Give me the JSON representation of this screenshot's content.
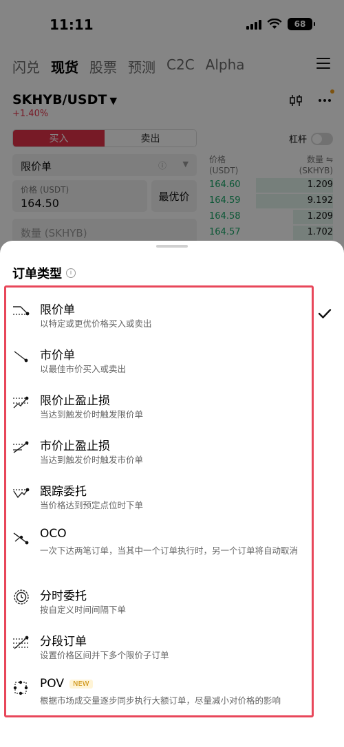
{
  "status_bar": {
    "time": "11:11",
    "battery": "68"
  },
  "nav_tabs": [
    {
      "label": "闪兑",
      "active": false
    },
    {
      "label": "现货",
      "active": true
    },
    {
      "label": "股票",
      "active": false
    },
    {
      "label": "预测",
      "active": false
    },
    {
      "label": "C2C",
      "active": false
    },
    {
      "label": "Alpha",
      "active": false
    }
  ],
  "market": {
    "pair": "SKHYB/USDT",
    "change": "+1.40%"
  },
  "trade_panel": {
    "buy_label": "买入",
    "sell_label": "卖出",
    "order_type_value": "限价单",
    "price_label": "价格 (USDT)",
    "price_value": "164.50",
    "best_price_label": "最优价",
    "quantity_placeholder": "数量 (SKHYB)",
    "leverage_label": "杠杆"
  },
  "order_book": {
    "price_header_1": "价格",
    "price_header_2": "(USDT)",
    "qty_header_1": "数量 ⇋",
    "qty_header_2": "(SKHYB)",
    "rows": [
      {
        "price": "164.60",
        "qty": "1.209",
        "depth": 0.62
      },
      {
        "price": "164.59",
        "qty": "9.192",
        "depth": 0.62
      },
      {
        "price": "164.58",
        "qty": "1.209",
        "depth": 0.32
      },
      {
        "price": "164.57",
        "qty": "1.702",
        "depth": 0.32
      }
    ]
  },
  "sheet": {
    "title": "订单类型",
    "selected_index": 0,
    "options": [
      {
        "name": "限价单",
        "desc": "以特定或更优价格买入或卖出",
        "icon": "limit-order-icon"
      },
      {
        "name": "市价单",
        "desc": "以最佳市价买入或卖出",
        "icon": "market-order-icon"
      },
      {
        "name": "限价止盈止损",
        "desc": "当达到触发价时触发限价单",
        "icon": "limit-tpsl-icon"
      },
      {
        "name": "市价止盈止损",
        "desc": "当达到触发价时触发市价单",
        "icon": "market-tpsl-icon"
      },
      {
        "name": "跟踪委托",
        "desc": "当价格达到预定点位时下单",
        "icon": "trailing-order-icon"
      },
      {
        "name": "OCO",
        "desc": "一次下达两笔订单，当其中一个订单执行时，另一个订单将自动取消",
        "icon": "oco-icon"
      },
      {
        "name": "分时委托",
        "desc": "按自定义时间间隔下单",
        "icon": "twap-clock-icon"
      },
      {
        "name": "分段订单",
        "desc": "设置价格区间并下多个限价子订单",
        "icon": "scaled-order-icon"
      },
      {
        "name": "POV",
        "badge": "NEW",
        "desc": "根据市场成交量逐步同步执行大额订单，尽量减小对价格的影响",
        "icon": "pov-icon"
      }
    ]
  }
}
